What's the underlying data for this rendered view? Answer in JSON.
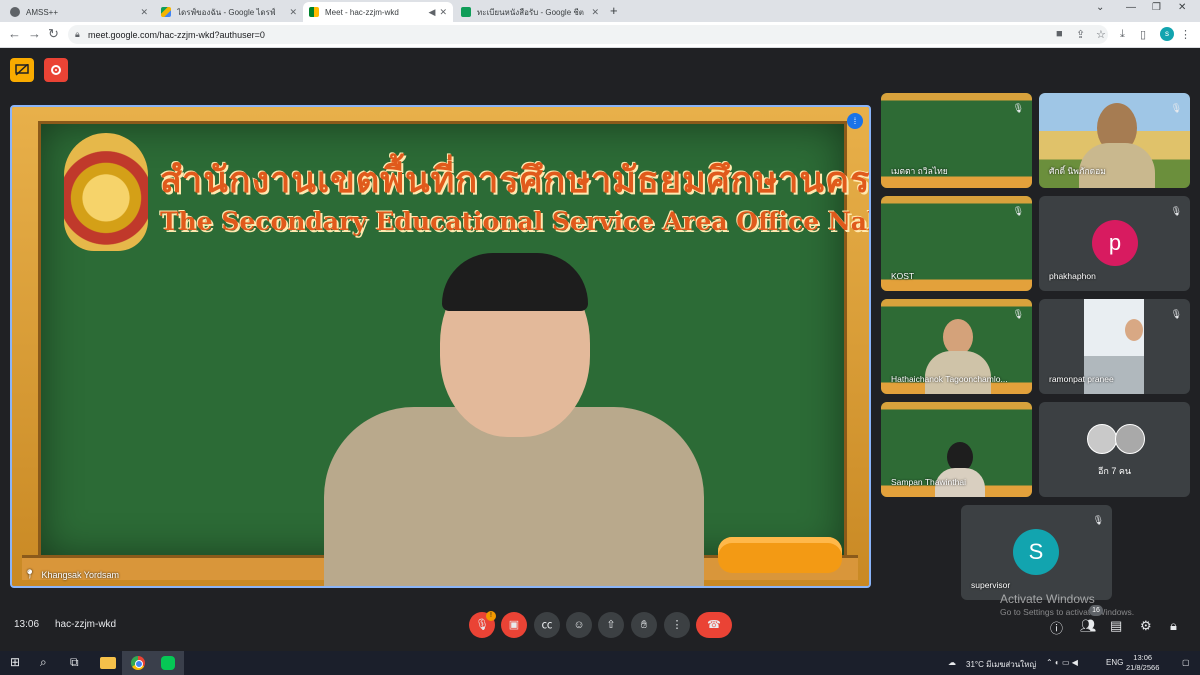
{
  "browser": {
    "tabs": [
      {
        "title": "AMSS++",
        "active": false
      },
      {
        "title": "ไดรฟ์ของฉัน - Google ไดรฟ์",
        "active": false
      },
      {
        "title": "Meet - hac-zzjm-wkd",
        "active": true
      },
      {
        "title": "ทะเบียนหนังสือรับ - Google ชีต",
        "active": false
      }
    ],
    "url": "meet.google.com/hac-zzjm-wkd?authuser=0",
    "profile_initial": "s"
  },
  "main_tile": {
    "banner_thai": "สำนักงานเขตพื้นที่การศึกษามัธยมศึกษานครสวรรค์",
    "banner_english": "The Secondary Educational Service Area Office Nakhon Sawan",
    "speaker_name": "Khangsak Yordsam"
  },
  "participants": [
    {
      "name": "เมตตา ถวิลไทย",
      "type": "video"
    },
    {
      "name": "ศักดิ์ นิพภักดอม",
      "type": "photo"
    },
    {
      "name": "KOST",
      "type": "video"
    },
    {
      "name": "phakhaphon",
      "type": "avatar",
      "initial": "p",
      "color": "#d81b60"
    },
    {
      "name": "Hathaichanok Tagoonchamlo...",
      "type": "video"
    },
    {
      "name": "ramonpat pranee",
      "type": "photo"
    },
    {
      "name": "Sampan Thawinthai",
      "type": "video"
    },
    {
      "name": "อีก 7 คน",
      "type": "more"
    },
    {
      "name": "supervisor",
      "type": "avatar",
      "initial": "S",
      "color": "#12a4af"
    }
  ],
  "bottom_bar": {
    "time": "13:06",
    "meeting_code": "hac-zzjm-wkd",
    "raise_badge": "!",
    "people_count": "16"
  },
  "watermark": {
    "line1": "Activate Windows",
    "line2": "Go to Settings to activate Windows."
  },
  "taskbar": {
    "weather": "31°C มีเมฆส่วนใหญ่",
    "language": "ENG",
    "time": "13:06",
    "date": "21/8/2566"
  }
}
